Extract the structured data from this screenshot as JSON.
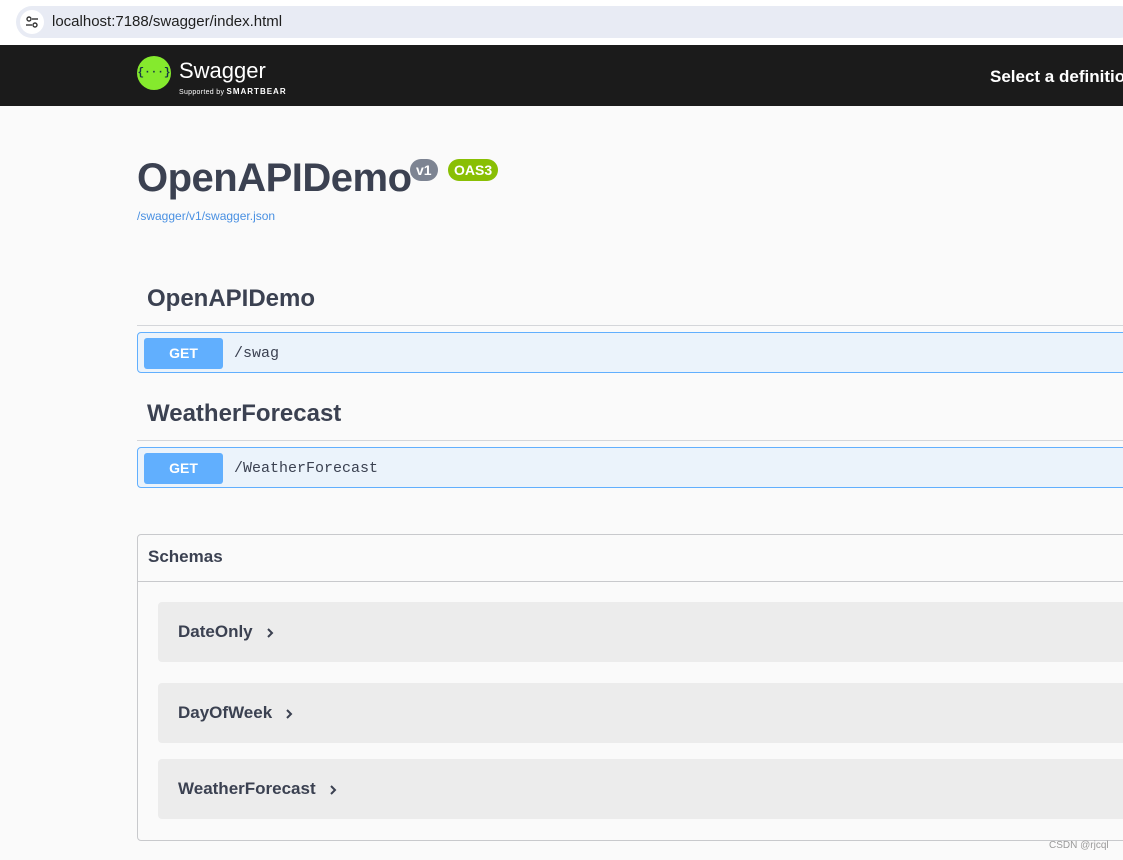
{
  "browser": {
    "url": "localhost:7188/swagger/index.html",
    "site_icon": "tune-icon"
  },
  "topbar": {
    "logo_text": "Swagger",
    "logo_sub_prefix": "Supported by",
    "logo_sub_brand": "SMARTBEAR",
    "logo_glyph": "{···}",
    "select_definition": "Select a definition",
    "background": "#1b1b1b",
    "logo_color": "#85ea2d"
  },
  "info": {
    "title": "OpenAPIDemo",
    "version_badge": "v1",
    "oas_badge": "OAS3",
    "spec_url": "/swagger/v1/swagger.json"
  },
  "tags": [
    {
      "name": "OpenAPIDemo",
      "operations": [
        {
          "method": "GET",
          "path": "/swag"
        }
      ]
    },
    {
      "name": "WeatherForecast",
      "operations": [
        {
          "method": "GET",
          "path": "/WeatherForecast"
        }
      ]
    }
  ],
  "schemas": {
    "title": "Schemas",
    "models": [
      "DateOnly",
      "DayOfWeek",
      "WeatherForecast"
    ]
  },
  "colors": {
    "get": "#61affe",
    "get_bg": "#ebf3fb",
    "oas3": "#89bf04",
    "version": "#7d8492"
  },
  "watermark": "CSDN @rjcql"
}
